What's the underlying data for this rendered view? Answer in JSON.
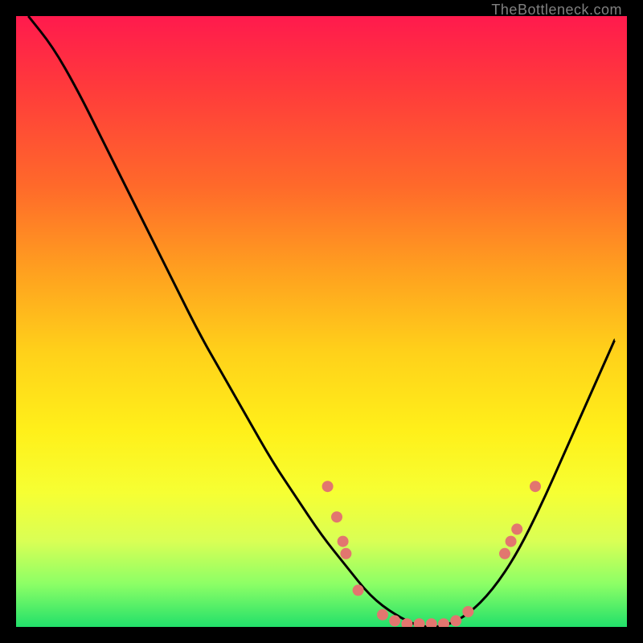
{
  "attribution": "TheBottleneck.com",
  "colors": {
    "gradient_top": "#ff1a4d",
    "gradient_bottom": "#22e06a",
    "curve_stroke": "#000000",
    "dot_fill": "#e2766f",
    "bg": "#000000"
  },
  "chart_data": {
    "type": "line",
    "title": "",
    "xlabel": "",
    "ylabel": "",
    "xlim": [
      0,
      100
    ],
    "ylim": [
      0,
      100
    ],
    "series": [
      {
        "name": "bottleneck-curve",
        "x": [
          2,
          6,
          10,
          14,
          18,
          22,
          26,
          30,
          34,
          38,
          42,
          46,
          50,
          54,
          58,
          62,
          66,
          70,
          74,
          78,
          82,
          86,
          90,
          94,
          98
        ],
        "y": [
          100,
          95,
          88,
          80,
          72,
          64,
          56,
          48,
          41,
          34,
          27,
          21,
          15,
          10,
          5,
          2,
          0,
          0,
          2,
          6,
          12,
          20,
          29,
          38,
          47
        ]
      }
    ],
    "points": [
      {
        "x": 51,
        "y": 23
      },
      {
        "x": 52.5,
        "y": 18
      },
      {
        "x": 53.5,
        "y": 14
      },
      {
        "x": 54,
        "y": 12
      },
      {
        "x": 56,
        "y": 6
      },
      {
        "x": 60,
        "y": 2
      },
      {
        "x": 62,
        "y": 1
      },
      {
        "x": 64,
        "y": 0.5
      },
      {
        "x": 66,
        "y": 0.5
      },
      {
        "x": 68,
        "y": 0.5
      },
      {
        "x": 70,
        "y": 0.5
      },
      {
        "x": 72,
        "y": 1
      },
      {
        "x": 74,
        "y": 2.5
      },
      {
        "x": 80,
        "y": 12
      },
      {
        "x": 81,
        "y": 14
      },
      {
        "x": 82,
        "y": 16
      },
      {
        "x": 85,
        "y": 23
      }
    ]
  }
}
